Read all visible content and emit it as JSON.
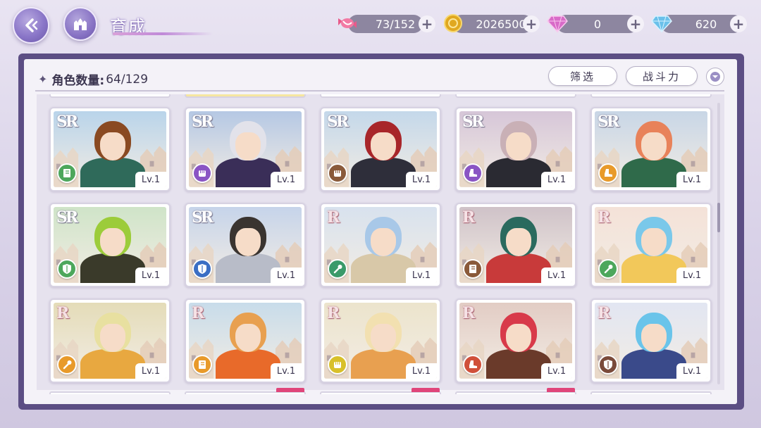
{
  "header": {
    "title": "育成",
    "resources": [
      {
        "name": "candy-stamina",
        "value": "73/152",
        "icon": "candy-icon"
      },
      {
        "name": "gold-coin",
        "value": "2026500",
        "icon": "gold-coin-icon"
      },
      {
        "name": "paid-diamond",
        "value": "0",
        "icon": "pink-diamond-icon"
      },
      {
        "name": "free-diamond",
        "value": "620",
        "icon": "blue-diamond-icon"
      }
    ]
  },
  "panel": {
    "count_label": "角色数量:",
    "count_value": "64/129",
    "filter_label": "筛选",
    "sort_label": "战斗力"
  },
  "colors": {
    "panel_frame": "#5c4e84",
    "resource_pill": "#8d86a0",
    "class_green": "#4da75c",
    "class_purple": "#8a55c4",
    "class_brown": "#8a5a3a",
    "class_orange": "#e89a2a",
    "class_blue": "#3a6ec4",
    "class_teal": "#3a9a6a",
    "class_yellow": "#d8c02a",
    "class_red": "#d0503a",
    "class_darkbrown": "#7a4a3a"
  },
  "cards": [
    {
      "rarity": "SR",
      "level": "Lv.1",
      "class_icon": "green-book-icon",
      "hair": "#8a4a22",
      "outfit": "#2f6a5a",
      "sky": "#b9d4ea"
    },
    {
      "rarity": "SR",
      "level": "Lv.1",
      "class_icon": "purple-fist-icon",
      "hair": "#e2e2ea",
      "outfit": "#3a2e58",
      "sky": "#b5c8e4"
    },
    {
      "rarity": "SR",
      "level": "Lv.1",
      "class_icon": "brown-fist-icon",
      "hair": "#a8262a",
      "outfit": "#2e2e3a",
      "sky": "#c4d8ea"
    },
    {
      "rarity": "SR",
      "level": "Lv.1",
      "class_icon": "purple-boot-icon",
      "hair": "#c9b0b6",
      "outfit": "#2a2a32",
      "sky": "#d6c6d8"
    },
    {
      "rarity": "SR",
      "level": "Lv.1",
      "class_icon": "orange-boot-icon",
      "hair": "#e8825a",
      "outfit": "#2f6a4a",
      "sky": "#c8d6e6"
    },
    {
      "rarity": "SR",
      "level": "Lv.1",
      "class_icon": "green-shield-icon",
      "hair": "#9ccc3a",
      "outfit": "#3a3a2a",
      "sky": "#cfe4c8"
    },
    {
      "rarity": "SR",
      "level": "Lv.1",
      "class_icon": "blue-shield-icon",
      "hair": "#3a3430",
      "outfit": "#b8bcc8",
      "sky": "#c6d4ea"
    },
    {
      "rarity": "R",
      "level": "Lv.1",
      "class_icon": "teal-wand-icon",
      "hair": "#a8c8e8",
      "outfit": "#d8c8a8",
      "sky": "#d8e2ee"
    },
    {
      "rarity": "R",
      "level": "Lv.1",
      "class_icon": "brown-book-icon",
      "hair": "#2a6a5e",
      "outfit": "#c83a3a",
      "sky": "#cfc2c8"
    },
    {
      "rarity": "R",
      "level": "Lv.1",
      "class_icon": "green-wand-icon",
      "hair": "#7ac8ea",
      "outfit": "#f2c85a",
      "sky": "#f4e2d8"
    },
    {
      "rarity": "R",
      "level": "Lv.1",
      "class_icon": "orange-wand-icon",
      "hair": "#e8e0a0",
      "outfit": "#e8a840",
      "sky": "#e4dcb8"
    },
    {
      "rarity": "R",
      "level": "Lv.1",
      "class_icon": "orange-book-icon",
      "hair": "#e8a050",
      "outfit": "#e86a2a",
      "sky": "#c8dcea"
    },
    {
      "rarity": "R",
      "level": "Lv.1",
      "class_icon": "yellow-fist-icon",
      "hair": "#f2e0b0",
      "outfit": "#e8a050",
      "sky": "#ece4cc"
    },
    {
      "rarity": "R",
      "level": "Lv.1",
      "class_icon": "red-boot-icon",
      "hair": "#d83a4a",
      "outfit": "#6a3a2a",
      "sky": "#e2ccc4"
    },
    {
      "rarity": "R",
      "level": "Lv.1",
      "class_icon": "brown-shield-icon",
      "hair": "#6ac4ea",
      "outfit": "#3a4a8a",
      "sky": "#e2e6f2"
    }
  ]
}
